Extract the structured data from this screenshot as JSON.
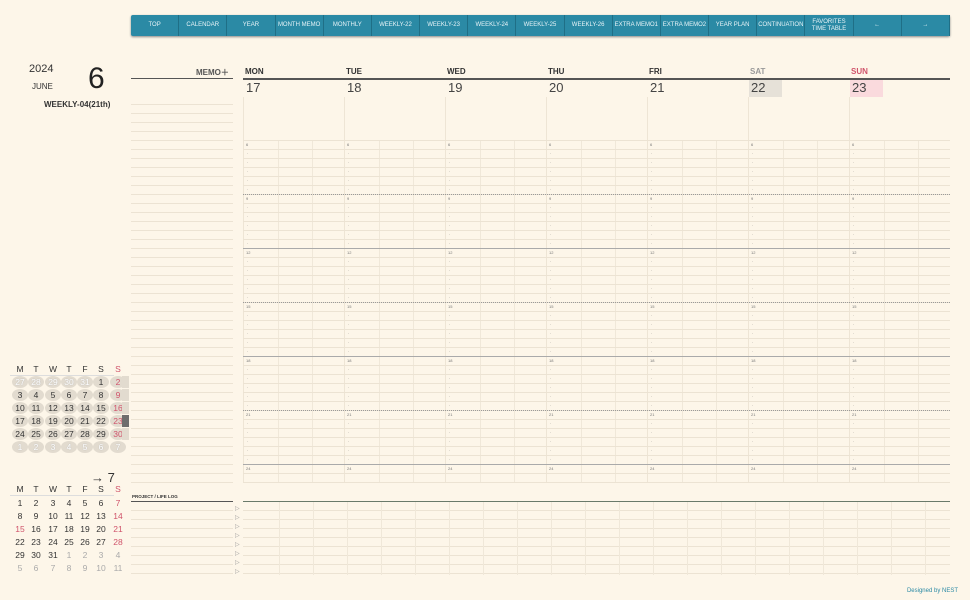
{
  "nav": [
    "TOP",
    "CALENDAR",
    "YEAR",
    "MONTH MEMO",
    "MONTHLY",
    "WEEKLY-22",
    "WEEKLY-23",
    "WEEKLY-24",
    "WEEKLY-25",
    "WEEKLY-26",
    "EXTRA MEMO1",
    "EXTRA MEMO2",
    "YEAR PLAN",
    "CONTINUATION",
    "FAVORITES TIME TABLE",
    "←",
    "→"
  ],
  "header": {
    "year": "2024",
    "month_name": "JUNE",
    "month_num": "6",
    "week": "WEEKLY-04(21th)",
    "memo": "MEMO＋"
  },
  "days": [
    {
      "name": "MON",
      "date": "17"
    },
    {
      "name": "TUE",
      "date": "18"
    },
    {
      "name": "WED",
      "date": "19"
    },
    {
      "name": "THU",
      "date": "20"
    },
    {
      "name": "FRI",
      "date": "21"
    },
    {
      "name": "SAT",
      "date": "22"
    },
    {
      "name": "SUN",
      "date": "23"
    }
  ],
  "hours": [
    "6",
    "9",
    "12",
    "15",
    "18",
    "21",
    "24"
  ],
  "weekday_headers": [
    "M",
    "T",
    "W",
    "T",
    "F",
    "S",
    "S"
  ],
  "june": [
    [
      "27",
      "28",
      "29",
      "30",
      "31",
      "1",
      "2"
    ],
    [
      "3",
      "4",
      "5",
      "6",
      "7",
      "8",
      "9"
    ],
    [
      "10",
      "11",
      "12",
      "13",
      "14",
      "15",
      "16"
    ],
    [
      "17",
      "18",
      "19",
      "20",
      "21",
      "22",
      "23"
    ],
    [
      "24",
      "25",
      "26",
      "27",
      "28",
      "29",
      "30"
    ],
    [
      "1",
      "2",
      "3",
      "4",
      "5",
      "6",
      "7"
    ]
  ],
  "july_label": "→ 7",
  "july": [
    [
      "1",
      "2",
      "3",
      "4",
      "5",
      "6",
      "7"
    ],
    [
      "8",
      "9",
      "10",
      "11",
      "12",
      "13",
      "14"
    ],
    [
      "15",
      "16",
      "17",
      "18",
      "19",
      "20",
      "21"
    ],
    [
      "22",
      "23",
      "24",
      "25",
      "26",
      "27",
      "28"
    ],
    [
      "29",
      "30",
      "31",
      "1",
      "2",
      "3",
      "4"
    ],
    [
      "5",
      "6",
      "7",
      "8",
      "9",
      "10",
      "11"
    ]
  ],
  "project_label": "PROJECT / LIFE LOG",
  "footer": "Designed by NEST",
  "colors": {
    "accent": "#2b8aa5",
    "sunday": "#d0546b"
  }
}
